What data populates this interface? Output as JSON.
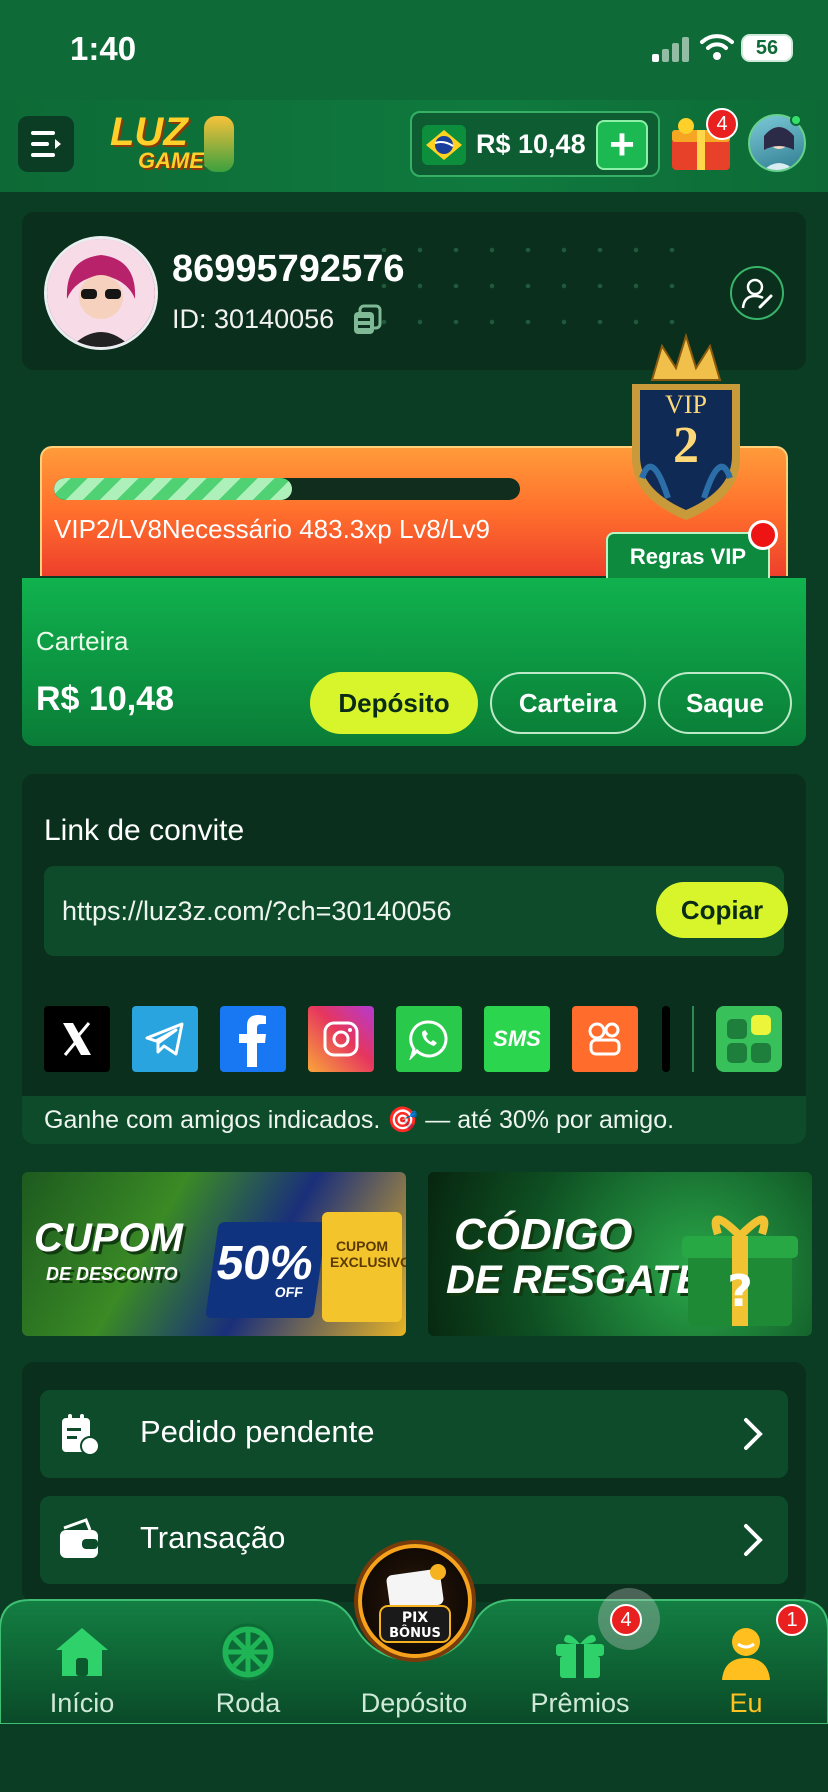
{
  "status_bar": {
    "time": "1:40",
    "battery": "56"
  },
  "header": {
    "logo_text_1": "LUZ",
    "logo_text_2": "GAMES",
    "balance": "R$ 10,48",
    "add_label": "+",
    "gift_badge": "4"
  },
  "profile": {
    "username": "86995792576",
    "id_text": "ID: 30140056"
  },
  "vip": {
    "badge_label": "VIP",
    "badge_level": "2",
    "progress_fraction": 0.51,
    "progress_text": "VIP2/LV8Necessário 483.3xp Lv8/Lv9",
    "rules_label": "Regras VIP"
  },
  "wallet": {
    "label": "Carteira",
    "balance": "R$ 10,48",
    "deposit_label": "Depósito",
    "wallet_label": "Carteira",
    "withdraw_label": "Saque"
  },
  "invite": {
    "title": "Link de convite",
    "link": "https://luz3z.com/?ch=30140056",
    "copy_label": "Copiar",
    "share_sms_label": "SMS",
    "note": "Ganhe com amigos indicados. 🎯 — até 30% por amigo."
  },
  "banners": {
    "coupon_line1": "CUPOM",
    "coupon_line2": "DE DESCONTO",
    "coupon_percent": "50%",
    "coupon_off": "OFF",
    "coupon_tag": "CUPOM EXCLUSIVO",
    "redeem_line1": "CÓDIGO",
    "redeem_line2": "DE RESGATE"
  },
  "menu": {
    "pending_order": "Pedido pendente",
    "transaction": "Transação"
  },
  "bottom_nav": {
    "home": "Início",
    "wheel": "Roda",
    "deposit": "Depósito",
    "prizes": "Prêmios",
    "me": "Eu",
    "prizes_badge": "4",
    "me_badge": "1",
    "pix_label": "PIX",
    "bonus_label": "BÔNUS"
  },
  "colors": {
    "background": "#0b3d24",
    "header": "#0e6a37",
    "accent_yellow": "#d7f52a",
    "active_nav": "#ffc21f",
    "badge_red": "#ea2020"
  },
  "icons": [
    "menu-icon",
    "brazil-flag-icon",
    "plus-icon",
    "gift-chest-icon",
    "copy-icon",
    "edit-profile-icon",
    "x-icon",
    "telegram-icon",
    "facebook-icon",
    "instagram-icon",
    "whatsapp-icon",
    "kwai-icon",
    "more-apps-icon",
    "order-icon",
    "wallet-icon",
    "chevron-right-icon",
    "home-icon",
    "wheel-icon",
    "gift-icon",
    "user-icon"
  ]
}
